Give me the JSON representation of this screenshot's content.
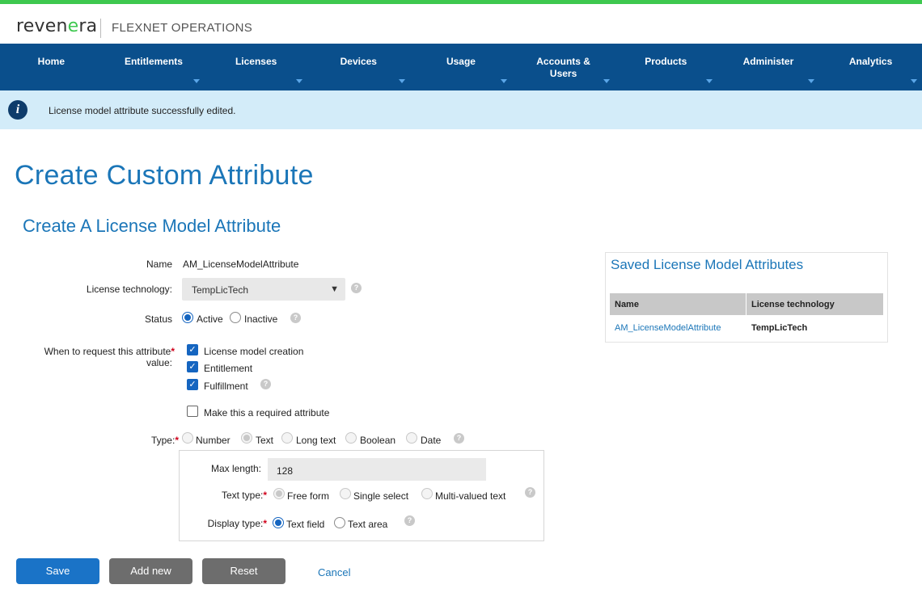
{
  "brand": {
    "logo_text": "reven",
    "logo_accent": "e",
    "logo_rest": "ra",
    "product_name": "FLEXNET OPERATIONS",
    "accent_color": "#3ec84f"
  },
  "nav": {
    "items": [
      {
        "label": "Home",
        "has_menu": false
      },
      {
        "label": "Entitlements",
        "has_menu": true
      },
      {
        "label": "Licenses",
        "has_menu": true
      },
      {
        "label": "Devices",
        "has_menu": true
      },
      {
        "label": "Usage",
        "has_menu": true
      },
      {
        "label": "Accounts &",
        "label2": "Users",
        "has_menu": true
      },
      {
        "label": "Products",
        "has_menu": true
      },
      {
        "label": "Administer",
        "has_menu": true
      },
      {
        "label": "Analytics",
        "has_menu": true
      }
    ],
    "bg_color": "#0a4f8c"
  },
  "alert": {
    "icon": "info-icon",
    "message": "License model attribute successfully edited."
  },
  "page": {
    "title": "Create Custom Attribute",
    "subtitle": "Create A License Model Attribute"
  },
  "form": {
    "name_label": "Name",
    "name_value": "AM_LicenseModelAttribute",
    "tech_label": "License technology:",
    "tech_value": "TempLicTech",
    "status_label": "Status",
    "status_active": "Active",
    "status_inactive": "Inactive",
    "status_selected": "Active",
    "when_label_1": "When to request this attribute",
    "when_label_2": "value:",
    "when_options": [
      {
        "label": "License model creation",
        "checked": true
      },
      {
        "label": "Entitlement",
        "checked": true
      },
      {
        "label": "Fulfillment",
        "checked": true
      }
    ],
    "required_label": "Make this a required attribute",
    "required_checked": false,
    "type_label": "Type:",
    "type_options": [
      "Number",
      "Text",
      "Long text",
      "Boolean",
      "Date"
    ],
    "type_selected": "Text",
    "maxlen_label": "Max length:",
    "maxlen_value": "128",
    "texttype_label": "Text type:",
    "texttype_options": [
      "Free form",
      "Single select",
      "Multi-valued text"
    ],
    "texttype_selected": "Free form",
    "display_label": "Display type:",
    "display_options": [
      "Text field",
      "Text area"
    ],
    "display_selected": "Text field",
    "required_marker": "*",
    "help_glyph": "?"
  },
  "actions": {
    "save": "Save",
    "add_new": "Add new",
    "reset": "Reset",
    "cancel": "Cancel"
  },
  "saved": {
    "title": "Saved License Model Attributes",
    "columns": [
      "Name",
      "License technology"
    ],
    "rows": [
      [
        "AM_LicenseModelAttribute",
        "TempLicTech"
      ]
    ]
  }
}
